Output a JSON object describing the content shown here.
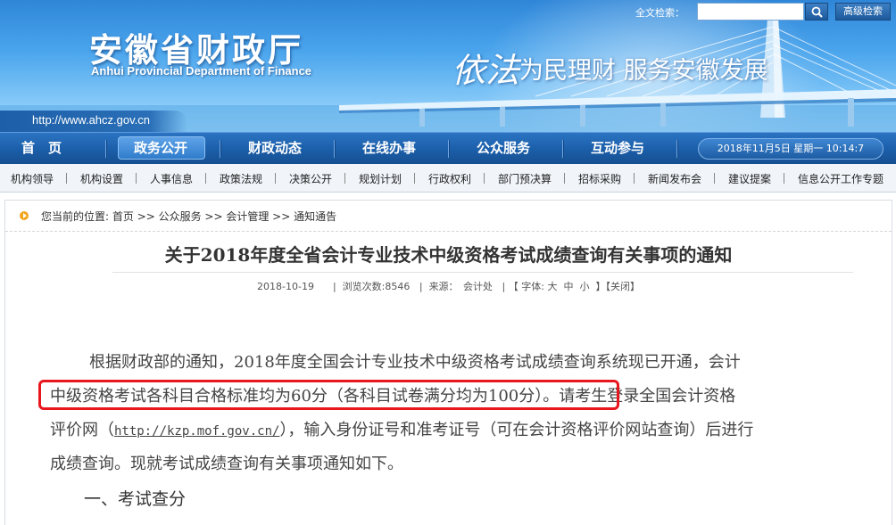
{
  "banner": {
    "title": "安徽省财政厅",
    "subtitle": "Anhui Provincial Department of Finance",
    "url": "http://www.ahcz.gov.cn",
    "slogan_big": "依法",
    "slogan_rest": "为民理财  服务安徽发展"
  },
  "search": {
    "label": "全文检索：",
    "value": "",
    "button_icon": "search-icon",
    "advanced_label": "高级检索"
  },
  "main_nav": {
    "items": [
      "首　页",
      "政务公开",
      "财政动态",
      "在线办事",
      "公众服务",
      "互动参与"
    ],
    "active": "政务公开",
    "datetime": "2018年11月5日 星期一 10:14:7"
  },
  "sub_nav": {
    "items": [
      "机构领导",
      "机构设置",
      "人事信息",
      "政策法规",
      "决策公开",
      "规划计划",
      "行政权利",
      "部门预决算",
      "招标采购",
      "新闻发布会",
      "建议提案",
      "信息公开工作专题"
    ]
  },
  "breadcrumb": {
    "prefix": "您当前的位置:",
    "path": "首页 >> 公众服务 >> 会计管理 >> 通知通告"
  },
  "article": {
    "title": "关于2018年度全省会计专业技术中级资格考试成绩查询有关事项的通知",
    "date": "2018-10-19",
    "views": "浏览次数:8546",
    "source": "来源：　会计处",
    "font_label": "【 字体:",
    "font_big": "大",
    "font_mid": "中",
    "font_small": "小",
    "close": "】【关闭】",
    "lines": {
      "l1": "根据财政部的通知，2018年度全国会计专业技术中级资格考试成绩查询系统现已开通，会计",
      "l2a": "中级资格考试各科目合格标准均为60分（各科目试卷满分均为100分）",
      "l2b": "。请考生登录全国会计资格",
      "l3a": "评价网（",
      "l3link": "http://kzp.mof.gov.cn/",
      "l3b": "），输入身份证号和准考证号（可在会计资格评价网站查询）后进行",
      "l4": "成绩查询。现就考试成绩查询有关事项通知如下。"
    },
    "section_1": "一、考试查分"
  },
  "colors": {
    "nav_blue": "#1b5ea9",
    "highlight_red": "#e8161d",
    "breadcrumb_dot": "#f2a51c"
  }
}
